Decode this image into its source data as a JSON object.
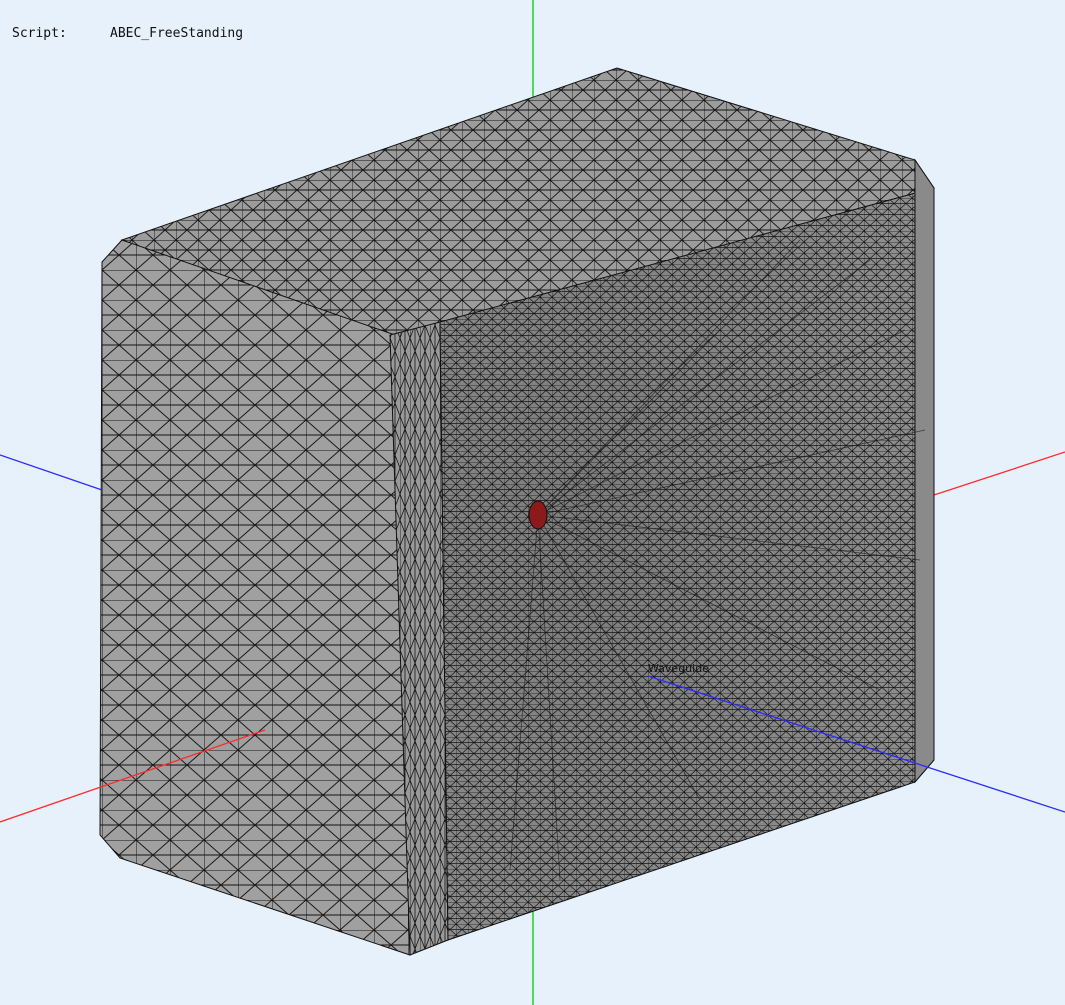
{
  "script": {
    "label": "Script:",
    "value": "ABEC_FreeStanding"
  },
  "model_label": "Waveguide",
  "colors": {
    "background": "#e6f1fc",
    "mesh_fill": "#a0a0a0",
    "mesh_edge": "#141414",
    "source": "#8b1a1a",
    "axis_x": "#ff2a2a",
    "axis_y": "#00cc00",
    "axis_z": "#2a2aff"
  },
  "icons": [
    "axis-gizmo",
    "mesh-box"
  ]
}
